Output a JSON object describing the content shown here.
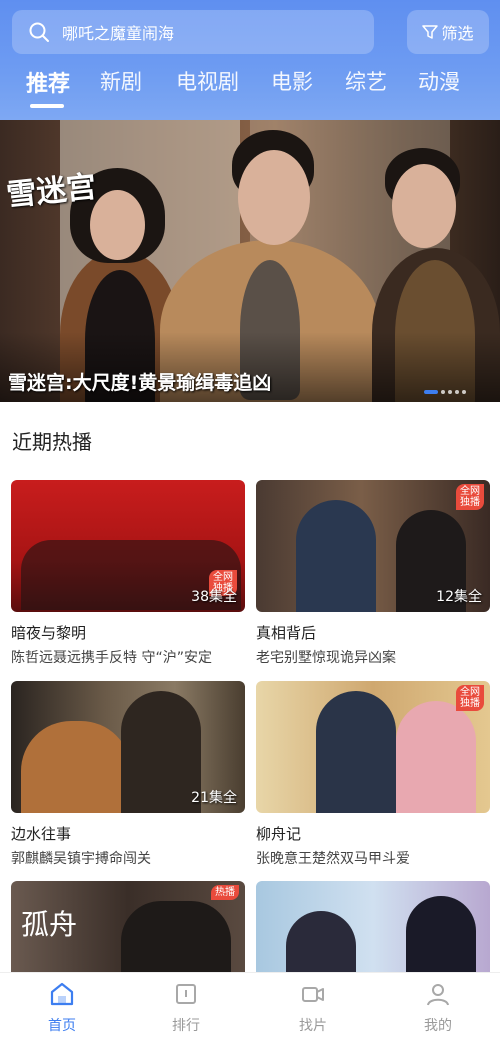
{
  "search": {
    "placeholder": "哪吒之魔童闹海"
  },
  "filter": {
    "label": "筛选"
  },
  "tabs": [
    {
      "label": "推荐",
      "active": true
    },
    {
      "label": "新剧"
    },
    {
      "label": "电视剧"
    },
    {
      "label": "电影"
    },
    {
      "label": "综艺"
    },
    {
      "label": "动漫"
    }
  ],
  "banner": {
    "logo_text": "雪迷宫",
    "caption": "雪迷宫:大尺度!黄景瑜缉毒追凶",
    "dots_count": 5
  },
  "section": {
    "title": "近期热播"
  },
  "cards": [
    {
      "title": "暗夜与黎明",
      "desc": "陈哲远聂远携手反特 守“沪”安定",
      "episodes": "38集全",
      "badge": "全网\n独播"
    },
    {
      "title": "真相背后",
      "desc": "老宅别墅惊现诡异凶案",
      "episodes": "12集全",
      "badge": "全网\n独播"
    },
    {
      "title": "边水往事",
      "desc": "郭麒麟吴镇宇搏命闯关",
      "episodes": "21集全",
      "badge": ""
    },
    {
      "title": "柳舟记",
      "desc": "张晚意王楚然双马甲斗爱",
      "episodes": "",
      "badge": "全网\n独播"
    },
    {
      "title": "孤舟",
      "desc": "",
      "episodes": "",
      "badge": "热播"
    },
    {
      "title": "",
      "desc": "",
      "episodes": "",
      "badge": ""
    }
  ],
  "bottom_nav": [
    {
      "label": "首页",
      "icon": "home-icon",
      "active": true
    },
    {
      "label": "排行",
      "icon": "ranking-icon"
    },
    {
      "label": "找片",
      "icon": "video-camera-icon"
    },
    {
      "label": "我的",
      "icon": "profile-icon"
    }
  ],
  "colors": {
    "accent": "#3d7ef0",
    "header": "#6e9cf2",
    "badge": "#e94b3c"
  }
}
